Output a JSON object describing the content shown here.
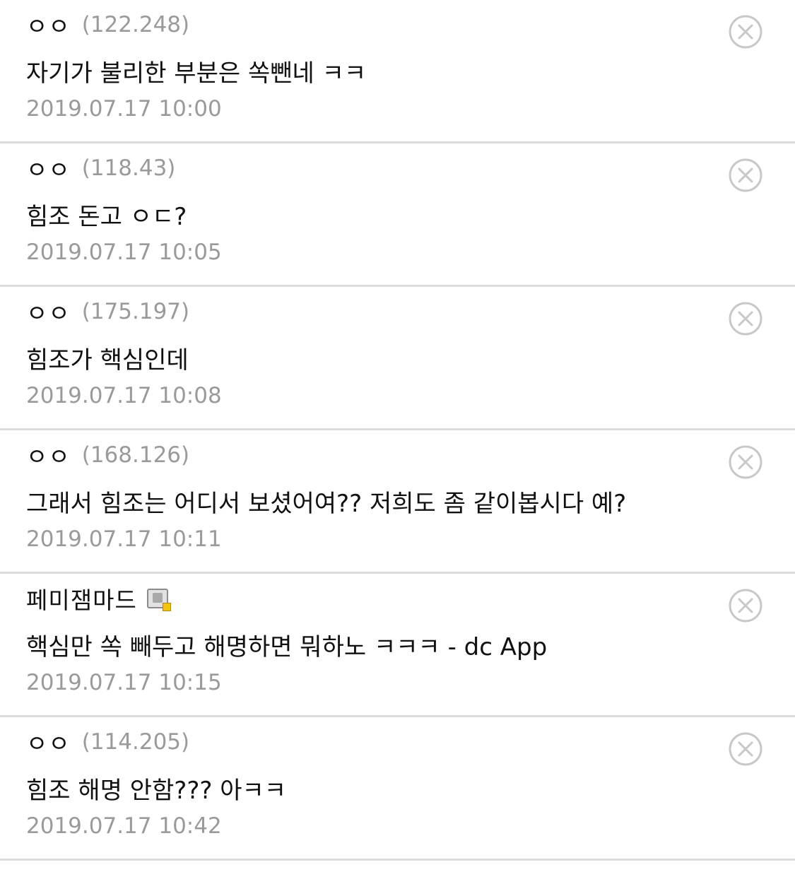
{
  "comments": [
    {
      "author": "ㅇㅇ",
      "ip": "(122.248)",
      "text": "자기가 불리한 부분은 쏙뺀네 ㅋㅋ",
      "date": "2019.07.17 10:00",
      "badge": null
    },
    {
      "author": "ㅇㅇ",
      "ip": "(118.43)",
      "text": "힘조 돈고 ㅇㄷ?",
      "date": "2019.07.17 10:05",
      "badge": null
    },
    {
      "author": "ㅇㅇ",
      "ip": "(175.197)",
      "text": "힘조가 핵심인데",
      "date": "2019.07.17 10:08",
      "badge": null
    },
    {
      "author": "ㅇㅇ",
      "ip": "(168.126)",
      "text": "그래서 힘조는 어디서 보셨어여?? 저희도 좀 같이봅시다 예?",
      "date": "2019.07.17 10:11",
      "badge": null
    },
    {
      "author": "페미잼마드",
      "ip": "",
      "text": "핵심만 쏙 빼두고 해명하면 뭐하노 ㅋㅋㅋ - dc App",
      "date": "2019.07.17 10:15",
      "badge": "member-badge-icon"
    },
    {
      "author": "ㅇㅇ",
      "ip": "(114.205)",
      "text": "힘조 해명 안함??? 아ㅋㅋ",
      "date": "2019.07.17 10:42",
      "badge": null
    }
  ],
  "icons": {
    "delete": "close-circle-icon"
  },
  "colors": {
    "text": "#111111",
    "muted": "#9a9a9a",
    "divider": "#dcdcdc",
    "icon": "#c8c8c8"
  }
}
